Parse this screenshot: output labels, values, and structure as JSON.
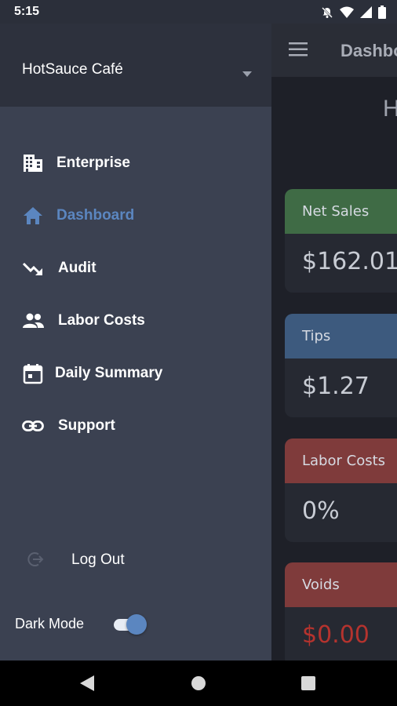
{
  "status_bar": {
    "time": "5:15",
    "icons": [
      "notifications-off-icon",
      "wifi-icon",
      "signal-icon",
      "battery-icon"
    ]
  },
  "app": {
    "title": "Dashbo",
    "header_letter": "H",
    "cards": [
      {
        "label": "Net Sales",
        "value": "$162.01",
        "header_color": "#3f6b45",
        "value_color": "#c8ccd4"
      },
      {
        "label": "Tips",
        "value": "$1.27",
        "header_color": "#3d5a7e",
        "value_color": "#c8ccd4"
      },
      {
        "label": "Labor Costs",
        "value": "0%",
        "header_color": "#7f3b3b",
        "value_color": "#c8ccd4"
      },
      {
        "label": "Voids",
        "value": "$0.00",
        "header_color": "#7f3b3b",
        "value_color": "#b5332e"
      }
    ]
  },
  "drawer": {
    "account_name": "HotSauce Café",
    "items": [
      {
        "label": "Enterprise",
        "icon": "building-icon",
        "active": false
      },
      {
        "label": "Dashboard",
        "icon": "home-icon",
        "active": true
      },
      {
        "label": "Audit",
        "icon": "trending-down-icon",
        "active": false
      },
      {
        "label": "Labor Costs",
        "icon": "people-icon",
        "active": false
      },
      {
        "label": "Daily Summary",
        "icon": "calendar-icon",
        "active": false
      },
      {
        "label": "Support",
        "icon": "link-icon",
        "active": false
      }
    ],
    "logout_label": "Log Out",
    "dark_mode_label": "Dark Mode",
    "dark_mode_on": true
  },
  "colors": {
    "accent": "#5b86c0",
    "drawer_bg": "#3b4151",
    "drawer_header_bg": "#2d313d"
  }
}
